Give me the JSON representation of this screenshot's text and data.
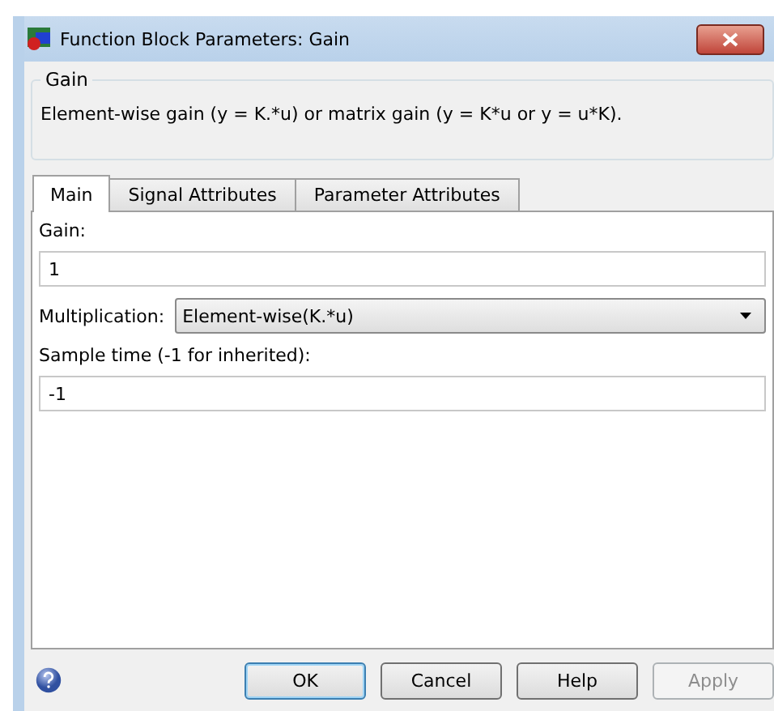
{
  "window": {
    "title": "Function Block Parameters: Gain"
  },
  "group": {
    "title": "Gain",
    "description": "Element-wise gain (y = K.*u) or matrix gain (y = K*u or y = u*K)."
  },
  "tabs": [
    {
      "label": "Main",
      "selected": true
    },
    {
      "label": "Signal Attributes",
      "selected": false
    },
    {
      "label": "Parameter Attributes",
      "selected": false
    }
  ],
  "fields": [
    {
      "kind": "text",
      "label": "Gain:",
      "value": "1"
    },
    {
      "kind": "dropdown",
      "label": "Multiplication:",
      "value": "Element-wise(K.*u)"
    },
    {
      "kind": "text",
      "label": "Sample time (-1 for inherited):",
      "value": "-1"
    }
  ],
  "buttons": [
    {
      "label": "OK",
      "default": true,
      "disabled": false
    },
    {
      "label": "Cancel",
      "default": false,
      "disabled": false
    },
    {
      "label": "Help",
      "default": false,
      "disabled": false
    },
    {
      "label": "Apply",
      "default": false,
      "disabled": true
    }
  ]
}
